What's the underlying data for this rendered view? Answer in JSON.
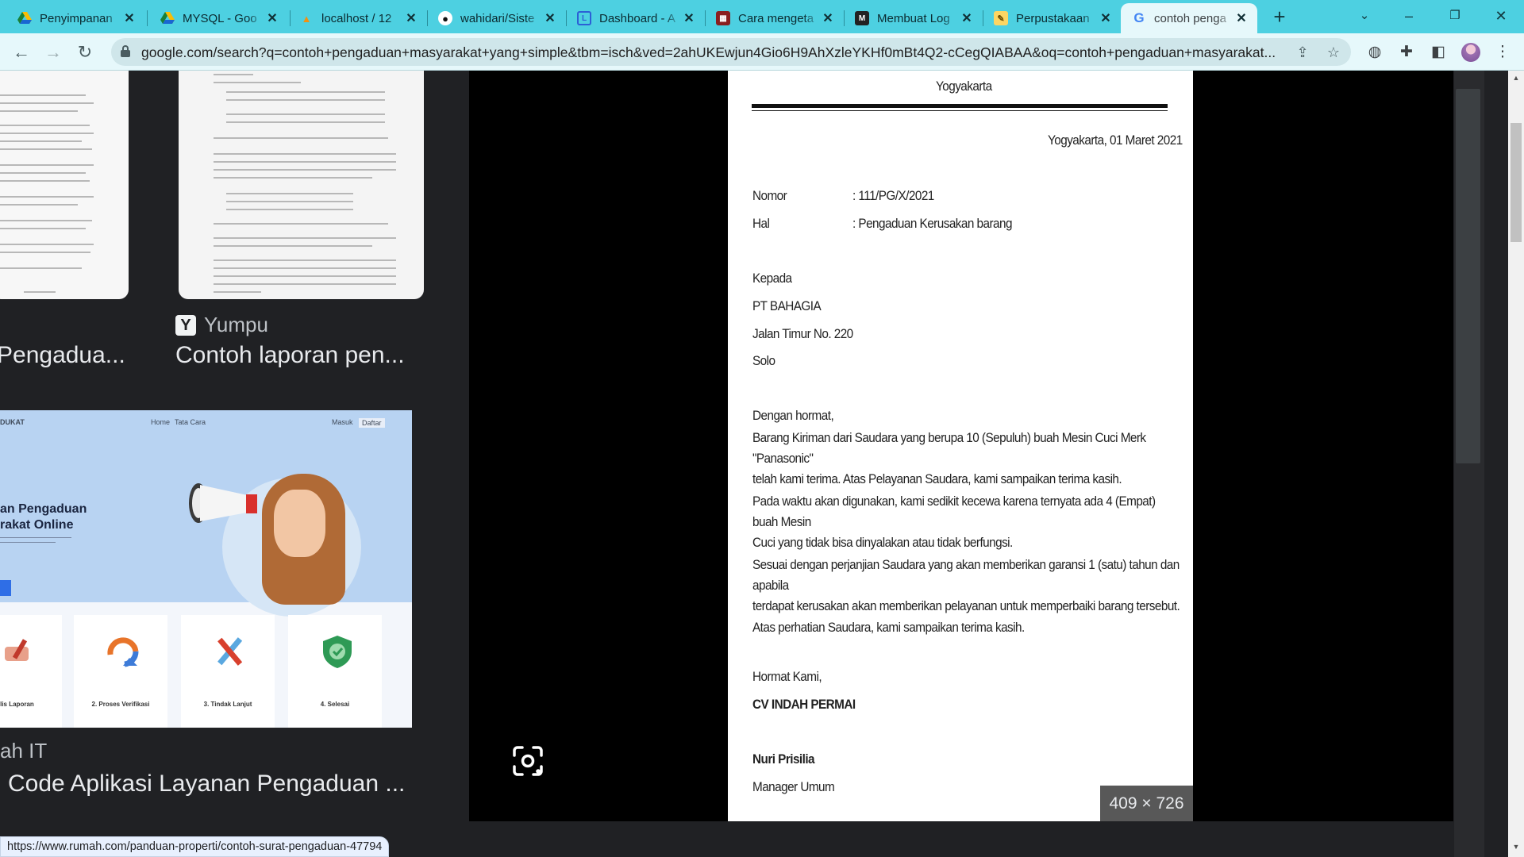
{
  "browser": {
    "tabs": [
      {
        "title": "Penyimpanan",
        "icon": "google-drive-icon"
      },
      {
        "title": "MYSQL - Goo",
        "icon": "google-drive-icon"
      },
      {
        "title": "localhost / 12",
        "icon": "phpmyadmin-icon"
      },
      {
        "title": "wahidari/Siste",
        "icon": "github-icon"
      },
      {
        "title": "Dashboard - A",
        "icon": "dashboard-icon"
      },
      {
        "title": "Cara mengeta",
        "icon": "calendar-icon"
      },
      {
        "title": "Membuat Log",
        "icon": "blog-icon"
      },
      {
        "title": "Perpustakaan",
        "icon": "notes-icon"
      },
      {
        "title": "contoh penga",
        "icon": "google-icon",
        "active": true
      }
    ],
    "url": "google.com/search?q=contoh+pengaduan+masyarakat+yang+simple&tbm=isch&ved=2ahUKEwjun4Gio6H9AhXzleYKHf0mBt4Q2-cCegQIABAA&oq=contoh+pengaduan+masyarakat...",
    "status_url": "https://www.rumah.com/panduan-properti/contoh-surat-pengaduan-47794"
  },
  "results": {
    "items": [
      {
        "source": "",
        "title": "Pengadua..."
      },
      {
        "source": "Yumpu",
        "title": "Contoh laporan pen..."
      },
      {
        "source": "ah IT",
        "title": "Code Aplikasi Layanan Pengaduan ..."
      }
    ],
    "hero": {
      "nav_left": "Home",
      "nav_mid": "Tata Cara",
      "nav_right1": "Masuk",
      "nav_right2": "Daftar",
      "brand": "DUKAT",
      "headline_1": "an Pengaduan",
      "headline_2": "rakat Online"
    },
    "cards": [
      {
        "label": "ulis Laporan"
      },
      {
        "label": "2. Proses Verifikasi"
      },
      {
        "label": "3. Tindak Lanjut"
      },
      {
        "label": "4. Selesai"
      }
    ]
  },
  "preview": {
    "dimensions": "409 × 726",
    "letter": {
      "city_header": "Yogyakarta",
      "date_line": "Yogyakarta, 01 Maret 2021",
      "nomor_label": "Nomor",
      "nomor_value": ": 111/PG/X/2021",
      "hal_label": "Hal",
      "hal_value": ": Pengaduan Kerusakan barang",
      "kepada": "Kepada",
      "recipient": "PT BAHAGIA",
      "address": "Jalan Timur No. 220",
      "city": "Solo",
      "greeting": "Dengan hormat,",
      "para1_line1": "Barang Kiriman dari Saudara yang berupa  10 (Sepuluh) buah Mesin Cuci Merk \"Panasonic\"",
      "para1_line2": "telah kami  terima. Atas Pelayanan Saudara, kami sampaikan terima kasih.",
      "para2_line1": "Pada waktu akan digunakan, kami sedikit kecewa karena ternyata ada 4 (Empat) buah Mesin",
      "para2_line2": "Cuci yang tidak bisa dinyalakan atau tidak berfungsi.",
      "para3_line1": "Sesuai dengan perjanjian Saudara yang akan memberikan garansi 1 (satu) tahun dan apabila",
      "para3_line2": "terdapat kerusakan akan memberikan pelayanan untuk memperbaiki barang tersebut.",
      "para4": "Atas perhatian Saudara, kami sampaikan terima kasih.",
      "closing": "Hormat Kami,",
      "company": "CV INDAH PERMAI",
      "signer": "Nuri Prisilia",
      "signer_title": "Manager Umum"
    }
  },
  "colors": {
    "tabstrip": "#4dd0e1",
    "toolbar": "#e6f8fb",
    "dark_bg": "#202124"
  }
}
